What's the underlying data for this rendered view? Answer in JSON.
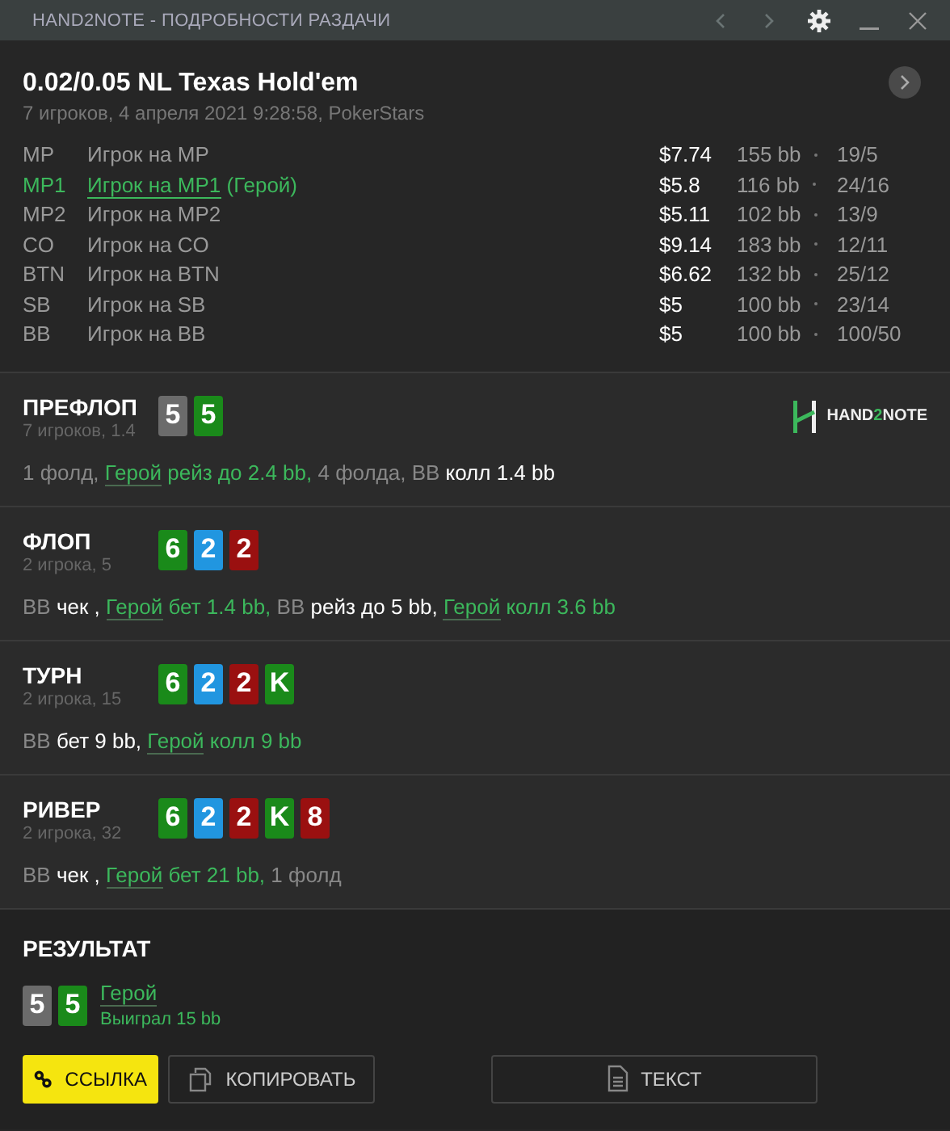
{
  "window": {
    "title": "HAND2NOTE - ПОДРОБНОСТИ РАЗДАЧИ",
    "nav": [
      {
        "kind": "back",
        "disabled": true
      },
      {
        "kind": "forward",
        "disabled": true
      }
    ]
  },
  "header": {
    "title": "0.02/0.05 NL Texas Hold'em",
    "subtitle": "7 игроков, 4 апреля 2021 9:28:58, PokerStars"
  },
  "players": [
    {
      "position": "MP",
      "name": "Игрок на MP",
      "hero": false,
      "stack": "$7.74",
      "bb": "155 bb",
      "stats": "19/5"
    },
    {
      "position": "MP1",
      "name": "Игрок на MP1",
      "hero": true,
      "hero_tag": "(Герой)",
      "stack": "$5.8",
      "bb": "116 bb",
      "stats": "24/16"
    },
    {
      "position": "MP2",
      "name": "Игрок на MP2",
      "hero": false,
      "stack": "$5.11",
      "bb": "102 bb",
      "stats": "13/9"
    },
    {
      "position": "CO",
      "name": "Игрок на CO",
      "hero": false,
      "stack": "$9.14",
      "bb": "183 bb",
      "stats": "12/11"
    },
    {
      "position": "BTN",
      "name": "Игрок на BTN",
      "hero": false,
      "stack": "$6.62",
      "bb": "132 bb",
      "stats": "25/12"
    },
    {
      "position": "SB",
      "name": "Игрок на SB",
      "hero": false,
      "stack": "$5",
      "bb": "100 bb",
      "stats": "23/14"
    },
    {
      "position": "BB",
      "name": "Игрок на BB",
      "hero": false,
      "stack": "$5",
      "bb": "100 bb",
      "stats": "100/50"
    }
  ],
  "streets": [
    {
      "title": "ПРЕФЛОП",
      "subtitle": "7 игроков, 1.4",
      "logo": {
        "prefix": "HAND",
        "accent": "2",
        "suffix": "NOTE"
      },
      "cards": [
        {
          "rank": "5",
          "color": "#6b6b6b"
        },
        {
          "rank": "5",
          "color": "#1a8a1a"
        }
      ],
      "actions": [
        {
          "text": "1 фолд, ",
          "kind": "muted"
        },
        {
          "text": "Герой",
          "kind": "hero_link"
        },
        {
          "text": " рейз до 2.4 bb,",
          "kind": "hero"
        },
        {
          "text": " 4 фолда, BB ",
          "kind": "muted"
        },
        {
          "text": "колл 1.4 bb",
          "kind": "active"
        }
      ]
    },
    {
      "title": "ФЛОП",
      "subtitle": "2 игрока, 5",
      "cards": [
        {
          "rank": "6",
          "color": "#1a8a1a"
        },
        {
          "rank": "2",
          "color": "#2196e0"
        },
        {
          "rank": "2",
          "color": "#9a1010"
        }
      ],
      "actions": [
        {
          "text": "BB ",
          "kind": "muted"
        },
        {
          "text": "чек , ",
          "kind": "active"
        },
        {
          "text": "Герой",
          "kind": "hero_link"
        },
        {
          "text": " бет 1.4 bb,",
          "kind": "hero"
        },
        {
          "text": " BB ",
          "kind": "muted"
        },
        {
          "text": "рейз до 5 bb, ",
          "kind": "active"
        },
        {
          "text": "Герой",
          "kind": "hero_link"
        },
        {
          "text": " колл 3.6 bb",
          "kind": "hero"
        }
      ]
    },
    {
      "title": "ТУРН",
      "subtitle": "2 игрока, 15",
      "cards": [
        {
          "rank": "6",
          "color": "#1a8a1a"
        },
        {
          "rank": "2",
          "color": "#2196e0"
        },
        {
          "rank": "2",
          "color": "#9a1010"
        },
        {
          "rank": "K",
          "color": "#1a8a1a"
        }
      ],
      "actions": [
        {
          "text": "BB ",
          "kind": "muted"
        },
        {
          "text": "бет 9 bb, ",
          "kind": "active"
        },
        {
          "text": "Герой",
          "kind": "hero_link"
        },
        {
          "text": " колл 9 bb",
          "kind": "hero"
        }
      ]
    },
    {
      "title": "РИВЕР",
      "subtitle": "2 игрока, 32",
      "cards": [
        {
          "rank": "6",
          "color": "#1a8a1a"
        },
        {
          "rank": "2",
          "color": "#2196e0"
        },
        {
          "rank": "2",
          "color": "#9a1010"
        },
        {
          "rank": "K",
          "color": "#1a8a1a"
        },
        {
          "rank": "8",
          "color": "#9a1010"
        }
      ],
      "actions": [
        {
          "text": "BB ",
          "kind": "muted"
        },
        {
          "text": "чек , ",
          "kind": "active"
        },
        {
          "text": "Герой",
          "kind": "hero_link"
        },
        {
          "text": " бет 21 bb,",
          "kind": "hero"
        },
        {
          "text": " 1 фолд",
          "kind": "muted"
        }
      ]
    }
  ],
  "result": {
    "title": "РЕЗУЛЬТАТ",
    "cards": [
      {
        "rank": "5",
        "color": "#6b6b6b"
      },
      {
        "rank": "5",
        "color": "#1a8a1a"
      }
    ],
    "winner": "Герой",
    "outcome": "Выиграл 15 bb"
  },
  "buttons": [
    {
      "label": "ССЫЛКА",
      "kind": "link"
    },
    {
      "label": "КОПИРОВАТЬ",
      "kind": "copy"
    },
    {
      "label": "ТЕКСТ",
      "kind": "text"
    }
  ]
}
